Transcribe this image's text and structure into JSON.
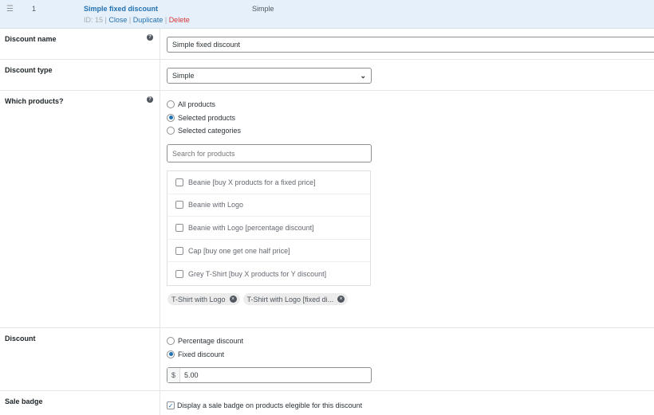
{
  "header": {
    "handle_icon": "drag-handle-icon",
    "number": "1",
    "title": "Simple fixed discount",
    "id_label": "ID: 15",
    "close": "Close",
    "duplicate": "Duplicate",
    "delete": "Delete",
    "type": "Simple",
    "sep": "|"
  },
  "discount_name": {
    "label": "Discount name",
    "help": "?",
    "value": "Simple fixed discount"
  },
  "discount_type": {
    "label": "Discount type",
    "value": "Simple",
    "chevron": "⌄"
  },
  "products": {
    "label": "Which products?",
    "help": "?",
    "options": [
      {
        "label": "All products",
        "selected": false
      },
      {
        "label": "Selected products",
        "selected": true
      },
      {
        "label": "Selected categories",
        "selected": false
      }
    ],
    "search_placeholder": "Search for products",
    "items": [
      "Beanie [buy X products for a fixed price]",
      "Beanie with Logo",
      "Beanie with Logo [percentage discount]",
      "Cap [buy one get one half price]",
      "Grey T-Shirt [buy X products for Y discount]"
    ],
    "selected": [
      "T-Shirt with Logo",
      "T-Shirt with Logo [fixed di..."
    ]
  },
  "discount": {
    "label": "Discount",
    "options": [
      {
        "label": "Percentage discount",
        "selected": false
      },
      {
        "label": "Fixed discount",
        "selected": true
      }
    ],
    "currency": "$",
    "amount": "5.00"
  },
  "sale_badge": {
    "label": "Sale badge",
    "checkbox": "Display a sale badge on products elegible for this discount",
    "checked": true
  }
}
